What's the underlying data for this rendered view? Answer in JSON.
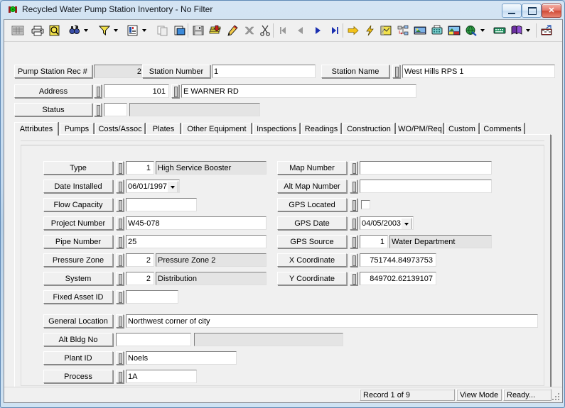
{
  "window": {
    "title": "Recycled Water Pump Station Inventory - No Filter",
    "app_icon": "pump-app-icon",
    "minimize_label": "Minimize",
    "maximize_label": "Maximize",
    "close_label": "Close"
  },
  "toolbar": {
    "buttons": [
      {
        "name": "grid-view-icon",
        "tip": "Grid View"
      },
      {
        "name": "print-icon",
        "tip": "Print"
      },
      {
        "name": "print-preview-icon",
        "tip": "Print Preview"
      },
      {
        "name": "find-icon",
        "tip": "Find"
      },
      {
        "name": "filter-icon",
        "tip": "Filter"
      },
      {
        "name": "report-icon",
        "tip": "Report"
      },
      {
        "name": "copy-icon",
        "tip": "Copy"
      },
      {
        "name": "paste-icon",
        "tip": "Paste"
      },
      {
        "name": "save-icon",
        "tip": "Save"
      },
      {
        "name": "add-record-icon",
        "tip": "Add Record"
      },
      {
        "name": "edit-record-icon",
        "tip": "Edit Record"
      },
      {
        "name": "delete-record-icon",
        "tip": "Delete Record"
      },
      {
        "name": "cut-icon",
        "tip": "Cut"
      },
      {
        "name": "first-record-icon",
        "tip": "First Record"
      },
      {
        "name": "previous-record-icon",
        "tip": "Previous Record"
      },
      {
        "name": "next-record-icon",
        "tip": "Next Record"
      },
      {
        "name": "last-record-icon",
        "tip": "Last Record"
      },
      {
        "name": "goto-icon",
        "tip": "Go To"
      },
      {
        "name": "quick-action-icon",
        "tip": "Quick Action"
      },
      {
        "name": "map-icon",
        "tip": "Map"
      },
      {
        "name": "hierarchy-icon",
        "tip": "Hierarchy"
      },
      {
        "name": "image-icon",
        "tip": "Image"
      },
      {
        "name": "fax-icon",
        "tip": "Fax"
      },
      {
        "name": "photo-icon",
        "tip": "Photo"
      },
      {
        "name": "globe-icon",
        "tip": "Internet"
      },
      {
        "name": "keyboard-icon",
        "tip": "Keyboard"
      },
      {
        "name": "book-icon",
        "tip": "Help Book"
      },
      {
        "name": "export-icon",
        "tip": "Export"
      }
    ]
  },
  "header": {
    "rec_label": "Pump Station Rec #",
    "rec_value": "2",
    "station_number_label": "Station Number",
    "station_number_value": "1",
    "station_name_label": "Station Name",
    "station_name_value": "West Hills RPS 1",
    "address_label": "Address",
    "address_number": "101",
    "address_street": "E WARNER RD",
    "status_label": "Status",
    "status_code": "",
    "status_desc": ""
  },
  "tabs": [
    {
      "label": "Attributes",
      "active": true
    },
    {
      "label": "Pumps",
      "active": false
    },
    {
      "label": "Costs/Assoc",
      "active": false
    },
    {
      "label": "Plates",
      "active": false
    },
    {
      "label": "Other Equipment",
      "active": false
    },
    {
      "label": "Inspections",
      "active": false
    },
    {
      "label": "Readings",
      "active": false
    },
    {
      "label": "Construction",
      "active": false
    },
    {
      "label": "WO/PM/Req",
      "active": false
    },
    {
      "label": "Custom",
      "active": false
    },
    {
      "label": "Comments",
      "active": false
    }
  ],
  "attributes": {
    "left": {
      "type_label": "Type",
      "type_code": "1",
      "type_desc": "High Service Booster",
      "date_installed_label": "Date Installed",
      "date_installed_value": "06/01/1997",
      "flow_capacity_label": "Flow Capacity",
      "flow_capacity_value": "",
      "project_number_label": "Project Number",
      "project_number_value": "W45-078",
      "pipe_number_label": "Pipe Number",
      "pipe_number_value": "25",
      "pressure_zone_label": "Pressure Zone",
      "pressure_zone_code": "2",
      "pressure_zone_desc": "Pressure Zone 2",
      "system_label": "System",
      "system_code": "2",
      "system_desc": "Distribution",
      "fixed_asset_label": "Fixed Asset ID",
      "fixed_asset_value": ""
    },
    "right": {
      "map_number_label": "Map Number",
      "map_number_value": "",
      "alt_map_number_label": "Alt Map Number",
      "alt_map_number_value": "",
      "gps_located_label": "GPS Located",
      "gps_located_checked": false,
      "gps_date_label": "GPS Date",
      "gps_date_value": "04/05/2003",
      "gps_source_label": "GPS Source",
      "gps_source_code": "1",
      "gps_source_desc": "Water Department",
      "x_coordinate_label": "X Coordinate",
      "x_coordinate_value": "751744.84973753",
      "y_coordinate_label": "Y Coordinate",
      "y_coordinate_value": "849702.62139107"
    },
    "bottom": {
      "general_location_label": "General Location",
      "general_location_value": "Northwest corner of city",
      "alt_bldg_no_label": "Alt Bldg No",
      "alt_bldg_no_value": "",
      "alt_bldg_no_desc": "",
      "plant_id_label": "Plant ID",
      "plant_id_value": "Noels",
      "process_label": "Process",
      "process_value": "1A"
    }
  },
  "statusbar": {
    "record": "Record 1 of 9",
    "mode": "View Mode",
    "state": "Ready..."
  },
  "colors": {
    "window_frame": "#b6d0e8",
    "client_bg": "#f0f0f0",
    "field_bg": "#ffffff",
    "field_readonly_bg": "#e4e4e4",
    "close_button": "#cf4a36"
  }
}
